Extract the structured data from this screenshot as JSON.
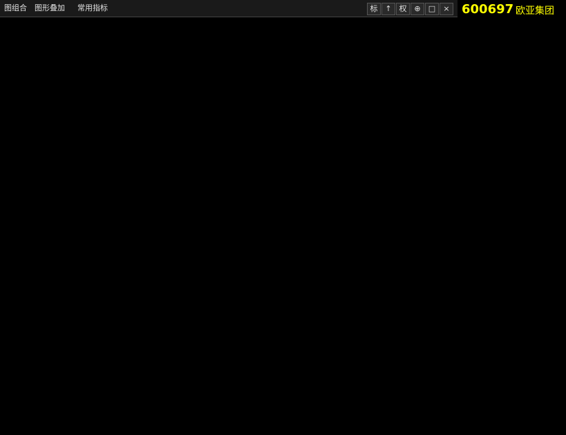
{
  "toolbar": {
    "combo_label": "图组合",
    "overlay_label": "图形叠加",
    "indicator_label": "常用指标",
    "icons": {
      "mark": "标",
      "back": "↑",
      "rights": "权",
      "crosshair": "⊕",
      "minimize": "□",
      "close": "×"
    }
  },
  "quote": {
    "code": "600697",
    "name": "欧亚集团"
  }
}
